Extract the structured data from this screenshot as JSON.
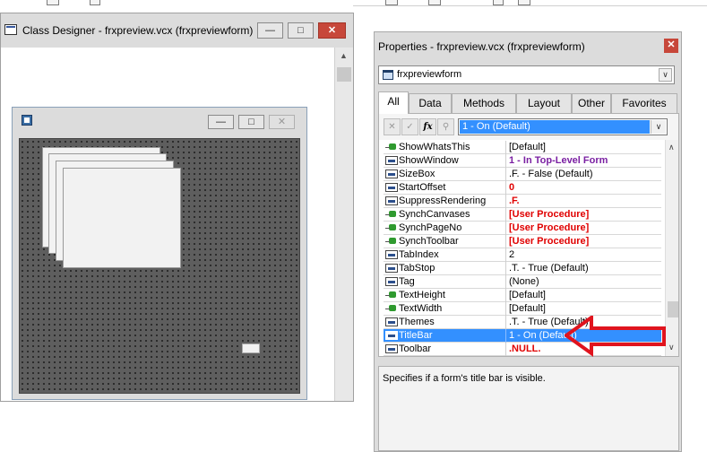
{
  "class_designer": {
    "title": "Class Designer - frxpreview.vcx (frxpreviewform)",
    "min_icon": "minimize-icon",
    "max_icon": "maximize-icon",
    "close_icon": "close-icon"
  },
  "inner_form": {
    "min_icon": "minimize-icon",
    "max_icon": "maximize-icon",
    "close_icon": "close-icon"
  },
  "properties": {
    "title": "Properties - frxpreview.vcx (frxpreviewform)",
    "object_combo": "frxpreviewform",
    "tabs": [
      {
        "label": "All",
        "active": true
      },
      {
        "label": "Data"
      },
      {
        "label": "Methods"
      },
      {
        "label": "Layout"
      },
      {
        "label": "Other"
      },
      {
        "label": "Favorites"
      }
    ],
    "value_combo": "1 - On (Default)",
    "rows": [
      {
        "name": "ShowWhatsThis",
        "value": "[Default]",
        "kind": "method",
        "style": "normal"
      },
      {
        "name": "ShowWindow",
        "value": "1 - In Top-Level Form",
        "kind": "prop",
        "style": "purple"
      },
      {
        "name": "SizeBox",
        "value": ".F. - False (Default)",
        "kind": "prop",
        "style": "normal"
      },
      {
        "name": "StartOffset",
        "value": "0",
        "kind": "prop",
        "style": "red"
      },
      {
        "name": "SuppressRendering",
        "value": ".F.",
        "kind": "prop",
        "style": "red"
      },
      {
        "name": "SynchCanvases",
        "value": "[User Procedure]",
        "kind": "method",
        "style": "red"
      },
      {
        "name": "SynchPageNo",
        "value": "[User Procedure]",
        "kind": "method",
        "style": "red"
      },
      {
        "name": "SynchToolbar",
        "value": "[User Procedure]",
        "kind": "method",
        "style": "red"
      },
      {
        "name": "TabIndex",
        "value": "2",
        "kind": "prop",
        "style": "normal"
      },
      {
        "name": "TabStop",
        "value": ".T. - True (Default)",
        "kind": "prop",
        "style": "normal"
      },
      {
        "name": "Tag",
        "value": "(None)",
        "kind": "prop",
        "style": "normal"
      },
      {
        "name": "TextHeight",
        "value": "[Default]",
        "kind": "method",
        "style": "normal"
      },
      {
        "name": "TextWidth",
        "value": "[Default]",
        "kind": "method",
        "style": "normal"
      },
      {
        "name": "Themes",
        "value": ".T. - True (Default)",
        "kind": "prop",
        "style": "normal"
      },
      {
        "name": "TitleBar",
        "value": "1 - On (Default)",
        "kind": "prop",
        "style": "selected"
      },
      {
        "name": "Toolbar",
        "value": ".NULL.",
        "kind": "prop",
        "style": "red"
      }
    ],
    "description": "Specifies if a form's title bar is visible.",
    "toolbar_icons": [
      "cancel-icon",
      "accept-icon",
      "fx-icon",
      "zoom-icon"
    ],
    "fx_label": "fx"
  },
  "colors": {
    "selection": "#3390ff",
    "purple_value": "#7a1fa2",
    "red_value": "#e00000",
    "callout": "#e0141e"
  }
}
